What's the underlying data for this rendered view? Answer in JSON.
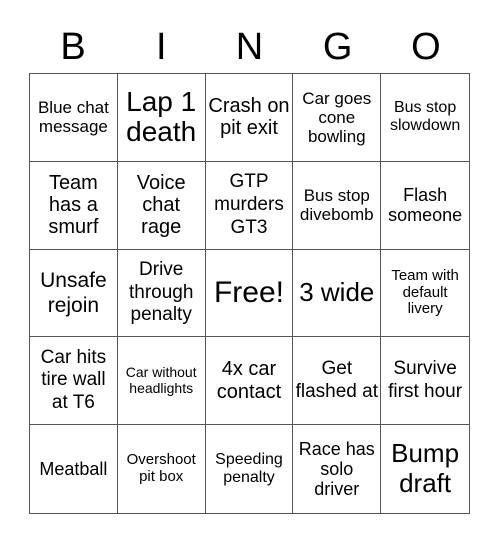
{
  "header": {
    "letters": [
      "B",
      "I",
      "N",
      "G",
      "O"
    ]
  },
  "cells": [
    "Blue chat message",
    "Lap 1 death",
    "Crash on pit exit",
    "Car goes cone bowling",
    "Bus stop slowdown",
    "Team has a smurf",
    "Voice chat rage",
    "GTP murders GT3",
    "Bus stop divebomb",
    "Flash someone",
    "Unsafe rejoin",
    "Drive through penalty",
    "Free!",
    "3 wide",
    "Team with default livery",
    "Car hits tire wall at T6",
    "Car without headlights",
    "4x car contact",
    "Get flashed at",
    "Survive first hour",
    "Meatball",
    "Overshoot pit box",
    "Speeding penalty",
    "Race has solo driver",
    "Bump draft"
  ]
}
